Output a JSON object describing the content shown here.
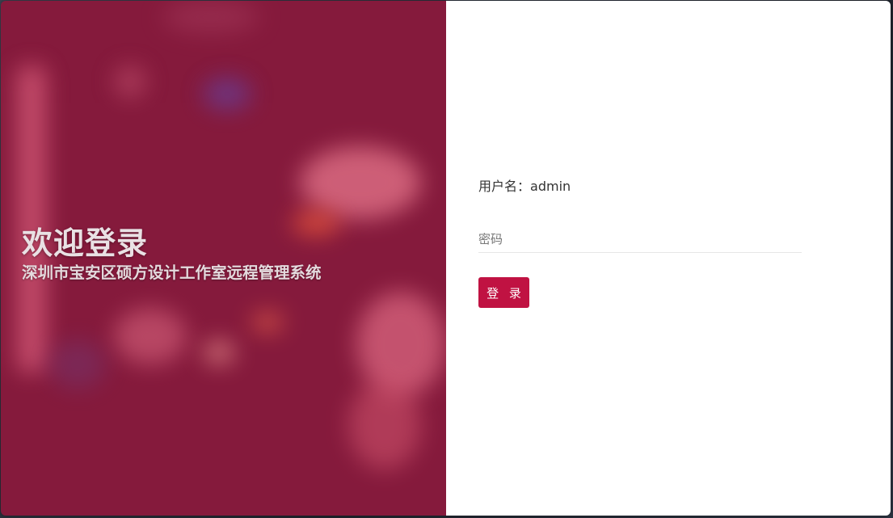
{
  "welcome": {
    "title": "欢迎登录",
    "subtitle": "深圳市宝安区硕方设计工作室远程管理系统"
  },
  "login_form": {
    "username_label": "用户名：",
    "username_value": "admin",
    "password_placeholder": "密码",
    "login_button_label": "登 录"
  },
  "colors": {
    "panel_background": "#851a3c",
    "button_accent": "#c01242"
  }
}
